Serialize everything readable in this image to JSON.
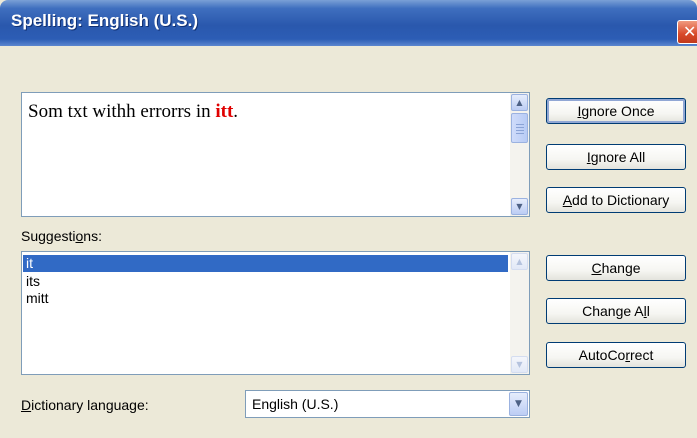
{
  "window": {
    "title": "Spelling: English (U.S.)",
    "close_glyph": "✕"
  },
  "editor": {
    "text_before": "Som txt withh errorrs in ",
    "text_error": "itt",
    "text_after": "."
  },
  "buttons": {
    "ignore_once": {
      "acc": "I",
      "rest": "gnore Once"
    },
    "ignore_all": {
      "acc": "I",
      "rest": "gnore All"
    },
    "add_to_dictionary": {
      "acc": "A",
      "rest": "dd to Dictionary"
    },
    "change": {
      "acc": "C",
      "rest": "hange"
    },
    "change_all": {
      "pre": "Change A",
      "acc": "l",
      "rest": "l"
    },
    "autocorrect": {
      "pre": "AutoCo",
      "acc": "r",
      "rest": "rect"
    }
  },
  "suggestions": {
    "label_pre": "Suggesti",
    "label_acc": "o",
    "label_rest": "ns:",
    "items": [
      "it",
      "its",
      "mitt"
    ],
    "selected_index": 0
  },
  "dictionary": {
    "label_acc": "D",
    "label_rest": "ictionary language:",
    "value": "English (U.S.)"
  },
  "icons": {
    "scroll_up": "▲",
    "scroll_down": "▼",
    "dropdown": "▼"
  },
  "colors": {
    "title_bar": "#2a58ad",
    "error_text": "#e00000",
    "selection": "#316ac5",
    "dialog_bg": "#ece9d8"
  }
}
